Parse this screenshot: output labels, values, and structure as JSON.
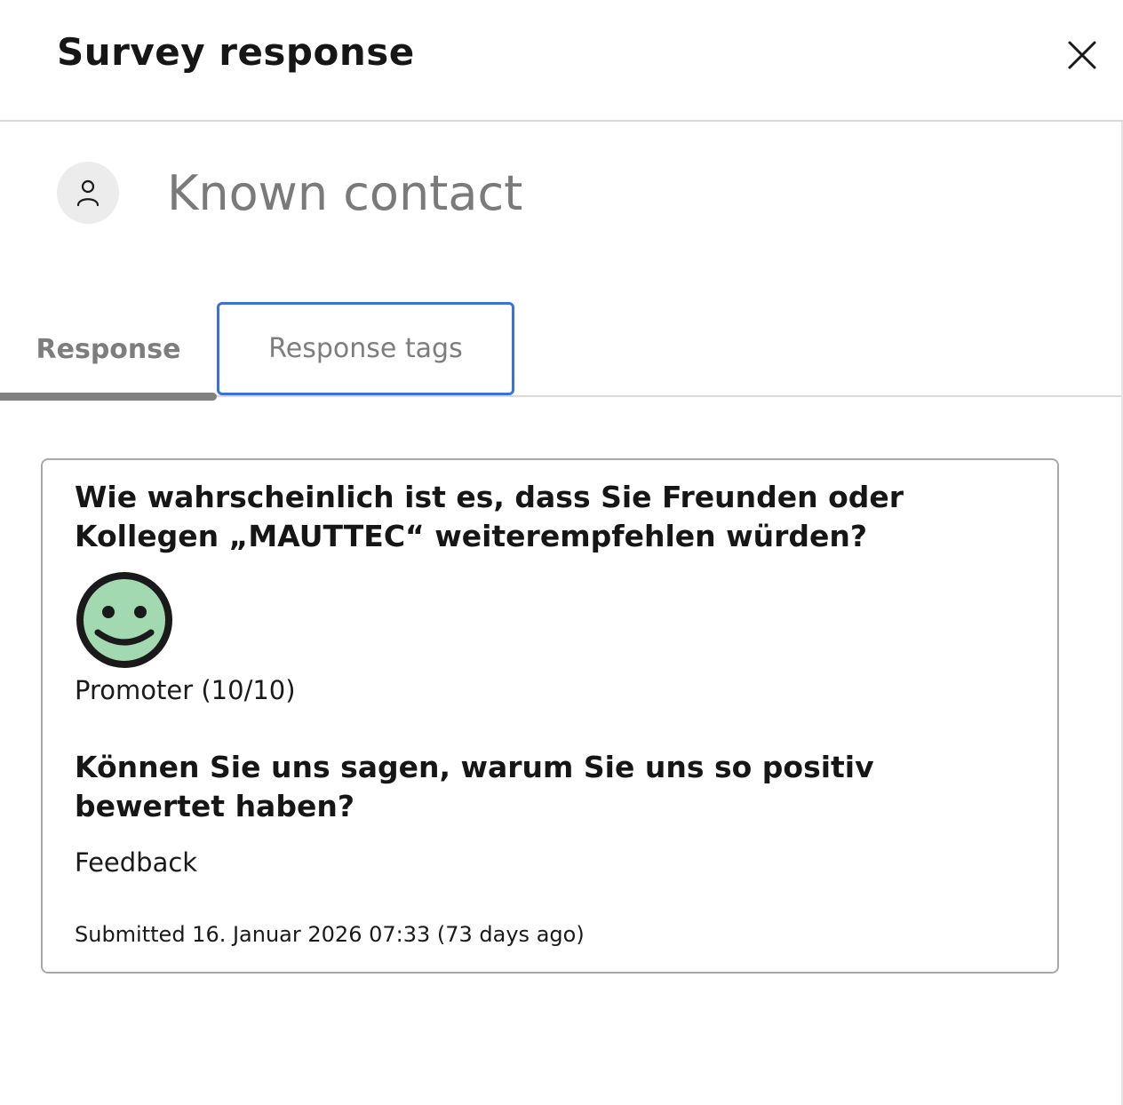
{
  "header": {
    "title": "Survey response",
    "close_icon": "close-icon"
  },
  "contact": {
    "avatar_icon": "person-icon",
    "name": "Known contact"
  },
  "tabs": [
    {
      "label": "Response",
      "active": true
    },
    {
      "label": "Response tags",
      "active": false,
      "focused": true
    }
  ],
  "card": {
    "question1": "Wie wahrscheinlich ist es, dass Sie Freunden oder Kollegen „MAUTTEC“ weiterempfehlen würden?",
    "rating_icon": "smiley-face-icon",
    "rating_color": "#a3d9b1",
    "rating_label": "Promoter (10/10)",
    "question2": "Können Sie uns sagen, warum Sie uns so positiv bewertet haben?",
    "answer": "Feedback",
    "submitted": "Submitted 16. Januar 2026 07:33 (73 days ago)"
  },
  "colors": {
    "focus_ring": "#3a73d6",
    "tab_underline": "#818181"
  }
}
